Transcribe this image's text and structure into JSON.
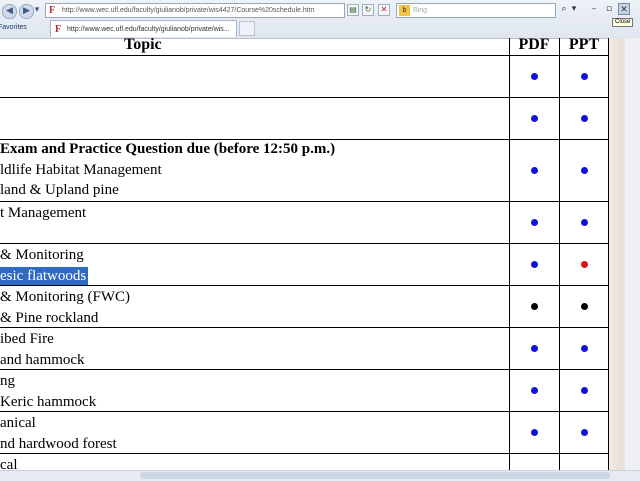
{
  "browser": {
    "address_url": "http://www.wec.ufl.edu/faculty/giulianob/private/wis4427/Course%20schedule.htm",
    "search_placeholder": "Bing",
    "tab_title": "http://www.wec.ufl.edu/faculty/giulianob/private/wis...",
    "favorites_label": "Favorites",
    "close_tooltip": "Close",
    "back_icon": "back-arrow",
    "forward_icon": "forward-arrow"
  },
  "table": {
    "headers": {
      "topic": "Topic",
      "pdf": "PDF",
      "ppt": "PPT"
    },
    "rows": [
      {
        "lines": [],
        "pdf": "blue",
        "ppt": "blue"
      },
      {
        "lines": [],
        "pdf": "blue",
        "ppt": "blue"
      },
      {
        "lines": [
          {
            "text": "Exam and Practice Question due (before 12:50 p.m.)",
            "bold": true
          },
          {
            "text": "ldlife Habitat Management"
          },
          {
            "text": "land & Upland pine"
          }
        ],
        "pdf": "blue",
        "ppt": "blue"
      },
      {
        "lines": [
          {
            "text": "t Management"
          }
        ],
        "pdf": "blue",
        "ppt": "blue"
      },
      {
        "lines": [
          {
            "text": " & Monitoring"
          },
          {
            "text": "esic flatwoods",
            "selected": true
          }
        ],
        "pdf": "blue",
        "ppt": "red"
      },
      {
        "lines": [
          {
            "text": " & Monitoring (FWC)"
          },
          {
            "text": "& Pine rockland"
          }
        ],
        "pdf": "black",
        "ppt": "black"
      },
      {
        "lines": [
          {
            "text": "ibed Fire"
          },
          {
            "text": "and hammock"
          }
        ],
        "pdf": "blue",
        "ppt": "blue"
      },
      {
        "lines": [
          {
            "text": "ng"
          },
          {
            "text": "Keric hammock"
          }
        ],
        "pdf": "blue",
        "ppt": "blue"
      },
      {
        "lines": [
          {
            "text": "anical"
          },
          {
            "text": "nd hardwood forest"
          }
        ],
        "pdf": "blue",
        "ppt": "blue"
      },
      {
        "lines": [
          {
            "text": "cal"
          }
        ],
        "pdf": "",
        "ppt": ""
      }
    ]
  },
  "colors": {
    "blue": "#1010e0",
    "red": "#e01010",
    "black": "#000000",
    "selection": "#316ac5"
  }
}
